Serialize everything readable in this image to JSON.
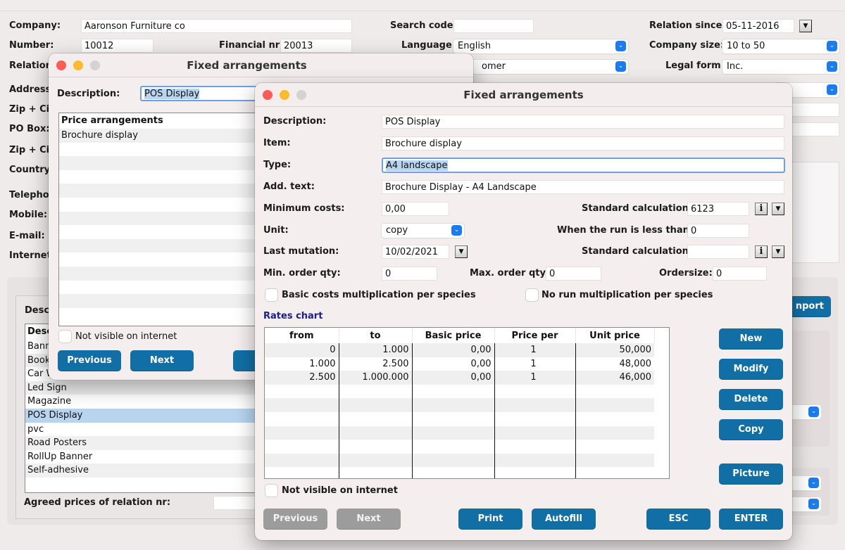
{
  "main": {
    "company_label": "Company:",
    "company_value": "Aaronson Furniture co",
    "search_code_label": "Search code:",
    "search_code_value": "",
    "relation_since_label": "Relation since:",
    "relation_since_value": "05-11-2016",
    "number_label": "Number:",
    "number_value": "10012",
    "financial_nr_label": "Financial nr:",
    "financial_nr_value": "20013",
    "language_label": "Language:",
    "language_value": "English",
    "company_size_label": "Company size:",
    "company_size_value": "10 to 50",
    "relation_label": "Relation",
    "relation_type_partial": "omer",
    "legal_form_label": "Legal form:",
    "legal_form_value": "Inc.",
    "address_label": "Address",
    "zip_city_label": "Zip + Ci",
    "po_box_label": "PO Box:",
    "zip_city2_label": "Zip + Ci",
    "country_label": "Country",
    "telephone_label": "Telepho",
    "mobile_label": "Mobile:",
    "email_label": "E-mail:",
    "internet_label": "Internet",
    "desc_section_label": "Desc",
    "desc_list_header": "Desc",
    "desc_list": [
      "Bann",
      "Book",
      "Car W",
      "Led Sign",
      "Magazine",
      "POS Display",
      "pvc",
      "Road Posters",
      "RollUp Banner",
      "Self-adhesive"
    ],
    "desc_selected_index": 5,
    "agreed_prices_label": "Agreed prices of relation nr:",
    "agreed_prices_value": "",
    "import_button": "nport"
  },
  "back_window": {
    "title": "Fixed arrangements",
    "description_label": "Description:",
    "description_value": "POS Display",
    "list_header": "Price arrangements",
    "list_items": [
      "Brochure display"
    ],
    "not_visible_label": "Not visible on internet",
    "previous_button": "Previous",
    "next_button": "Next"
  },
  "front_window": {
    "title": "Fixed arrangements",
    "description_label": "Description:",
    "description_value": "POS Display",
    "item_label": "Item:",
    "item_value": "Brochure display",
    "type_label": "Type:",
    "type_value": "A4 landscape",
    "add_text_label": "Add. text:",
    "add_text_value": "Brochure Display - A4 Landscape",
    "minimum_costs_label": "Minimum costs:",
    "minimum_costs_value": "0,00",
    "standard_calc_label": "Standard calculation:",
    "standard_calc_value": "6123",
    "unit_label": "Unit:",
    "unit_value": "copy",
    "run_less_label": "When the run is less than:",
    "run_less_value": "0",
    "last_mutation_label": "Last mutation:",
    "last_mutation_value": "10/02/2021",
    "standard_calc2_label": "Standard calculation:",
    "standard_calc2_value": "",
    "min_order_label": "Min. order qty:",
    "min_order_value": "0",
    "max_order_label": "Max. order qty:",
    "max_order_value": "0",
    "ordersize_label": "Ordersize:",
    "ordersize_value": "0",
    "basic_costs_label": "Basic costs multiplication per species",
    "no_run_label": "No run multiplication per species",
    "rates_chart_label": "Rates chart",
    "rates_columns": [
      "from",
      "to",
      "Basic price",
      "Price per",
      "Unit price"
    ],
    "rates_rows": [
      [
        "0",
        "1.000",
        "0,00",
        "1",
        "50,000"
      ],
      [
        "1.000",
        "2.500",
        "0,00",
        "1",
        "48,000"
      ],
      [
        "2.500",
        "1.000.000",
        "0,00",
        "1",
        "46,000"
      ]
    ],
    "not_visible_label": "Not visible on internet",
    "buttons": {
      "new": "New",
      "modify": "Modify",
      "delete": "Delete",
      "copy": "Copy",
      "picture": "Picture",
      "previous": "Previous",
      "next": "Next",
      "print": "Print",
      "autofill": "Autofill",
      "esc": "ESC",
      "enter": "ENTER"
    },
    "info_icon_glyph": "i",
    "dropdown_glyph": "▼"
  },
  "colors": {
    "accent_button": "#116fa5",
    "disabled_button": "#9c9c9c",
    "select_arrow": "#1a7cf0",
    "rates_chart_title": "#1b1b8a",
    "selection": "#b8d4ef"
  }
}
